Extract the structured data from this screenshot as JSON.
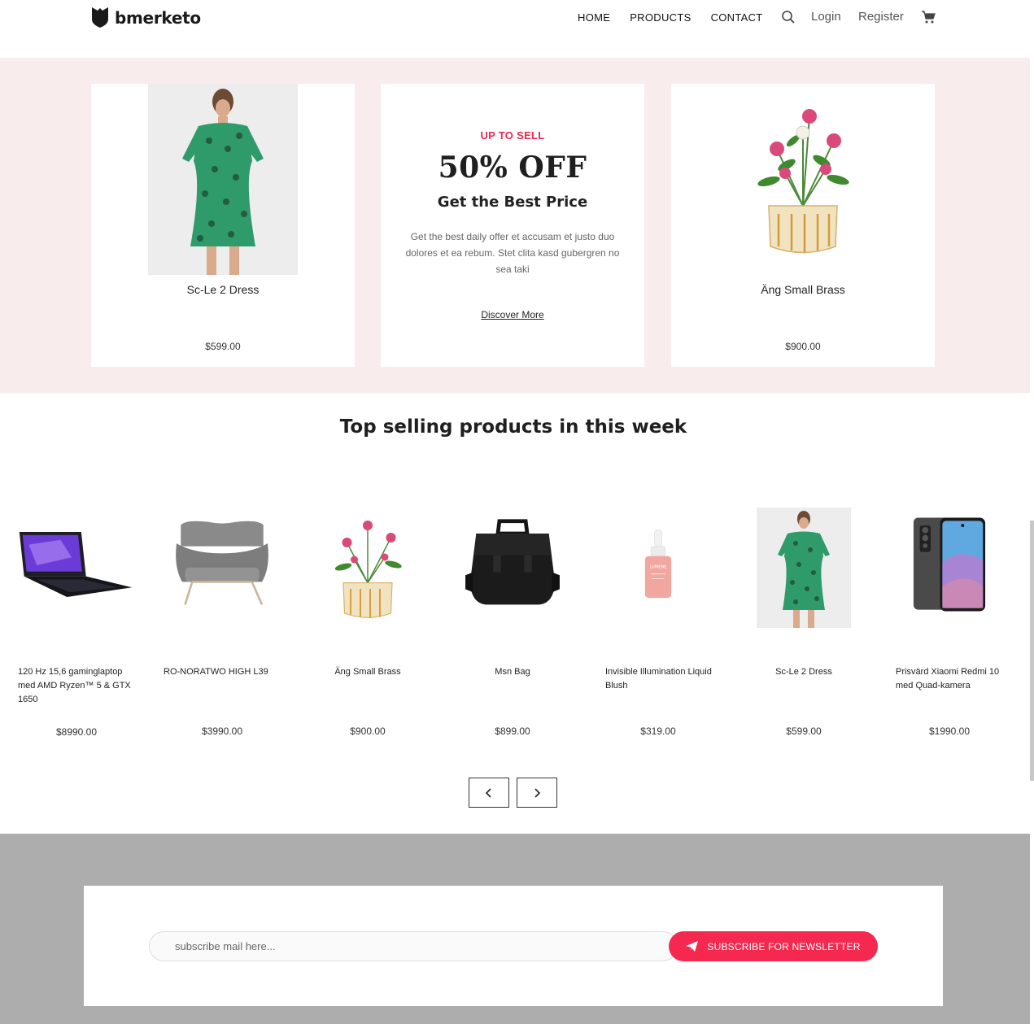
{
  "brand": {
    "name": "bmerketo"
  },
  "nav": {
    "items": [
      "HOME",
      "PRODUCTS",
      "CONTACT"
    ],
    "login": "Login",
    "register": "Register",
    "search_icon": "search-icon",
    "cart_icon": "cart-icon"
  },
  "promo": {
    "left_card": {
      "name": "Sc-Le 2 Dress",
      "price": "$599.00"
    },
    "offer": {
      "kicker": "UP TO SELL",
      "headline": "50% OFF",
      "subheadline": "Get the Best Price",
      "description": "Get the best daily offer et accusam et justo duo dolores et ea rebum. Stet clita kasd gubergren no sea taki",
      "link": "Discover More"
    },
    "right_card": {
      "name": "Äng Small Brass",
      "price": "$900.00"
    }
  },
  "top_selling": {
    "title": "Top selling products in this week",
    "products": [
      {
        "name": "120 Hz 15,6 gaminglaptop med AMD Ryzen™ 5 & GTX 1650",
        "price": "$8990.00"
      },
      {
        "name": "RO-NORATWO HIGH L39",
        "price": "$3990.00"
      },
      {
        "name": "Äng Small Brass",
        "price": "$900.00"
      },
      {
        "name": "Msn Bag",
        "price": "$899.00"
      },
      {
        "name": "Invisible Illumination Liquid Blush",
        "price": "$319.00"
      },
      {
        "name": "Sc-Le 2 Dress",
        "price": "$599.00"
      },
      {
        "name": "Prisvärd Xiaomi Redmi 10 med Quad-kamera",
        "price": "$1990.00"
      }
    ],
    "blush_label": "LUMENE",
    "pager_prev_icon": "chevron-left-icon",
    "pager_next_icon": "chevron-right-icon"
  },
  "newsletter": {
    "placeholder": "subscribe mail here...",
    "button_label": "SUBSCRIBE FOR NEWSLETTER",
    "button_icon": "paper-plane-icon"
  },
  "colors": {
    "accent": "#f5284f",
    "promo_bg": "#f8ecec",
    "footer_bg": "#adadad"
  }
}
